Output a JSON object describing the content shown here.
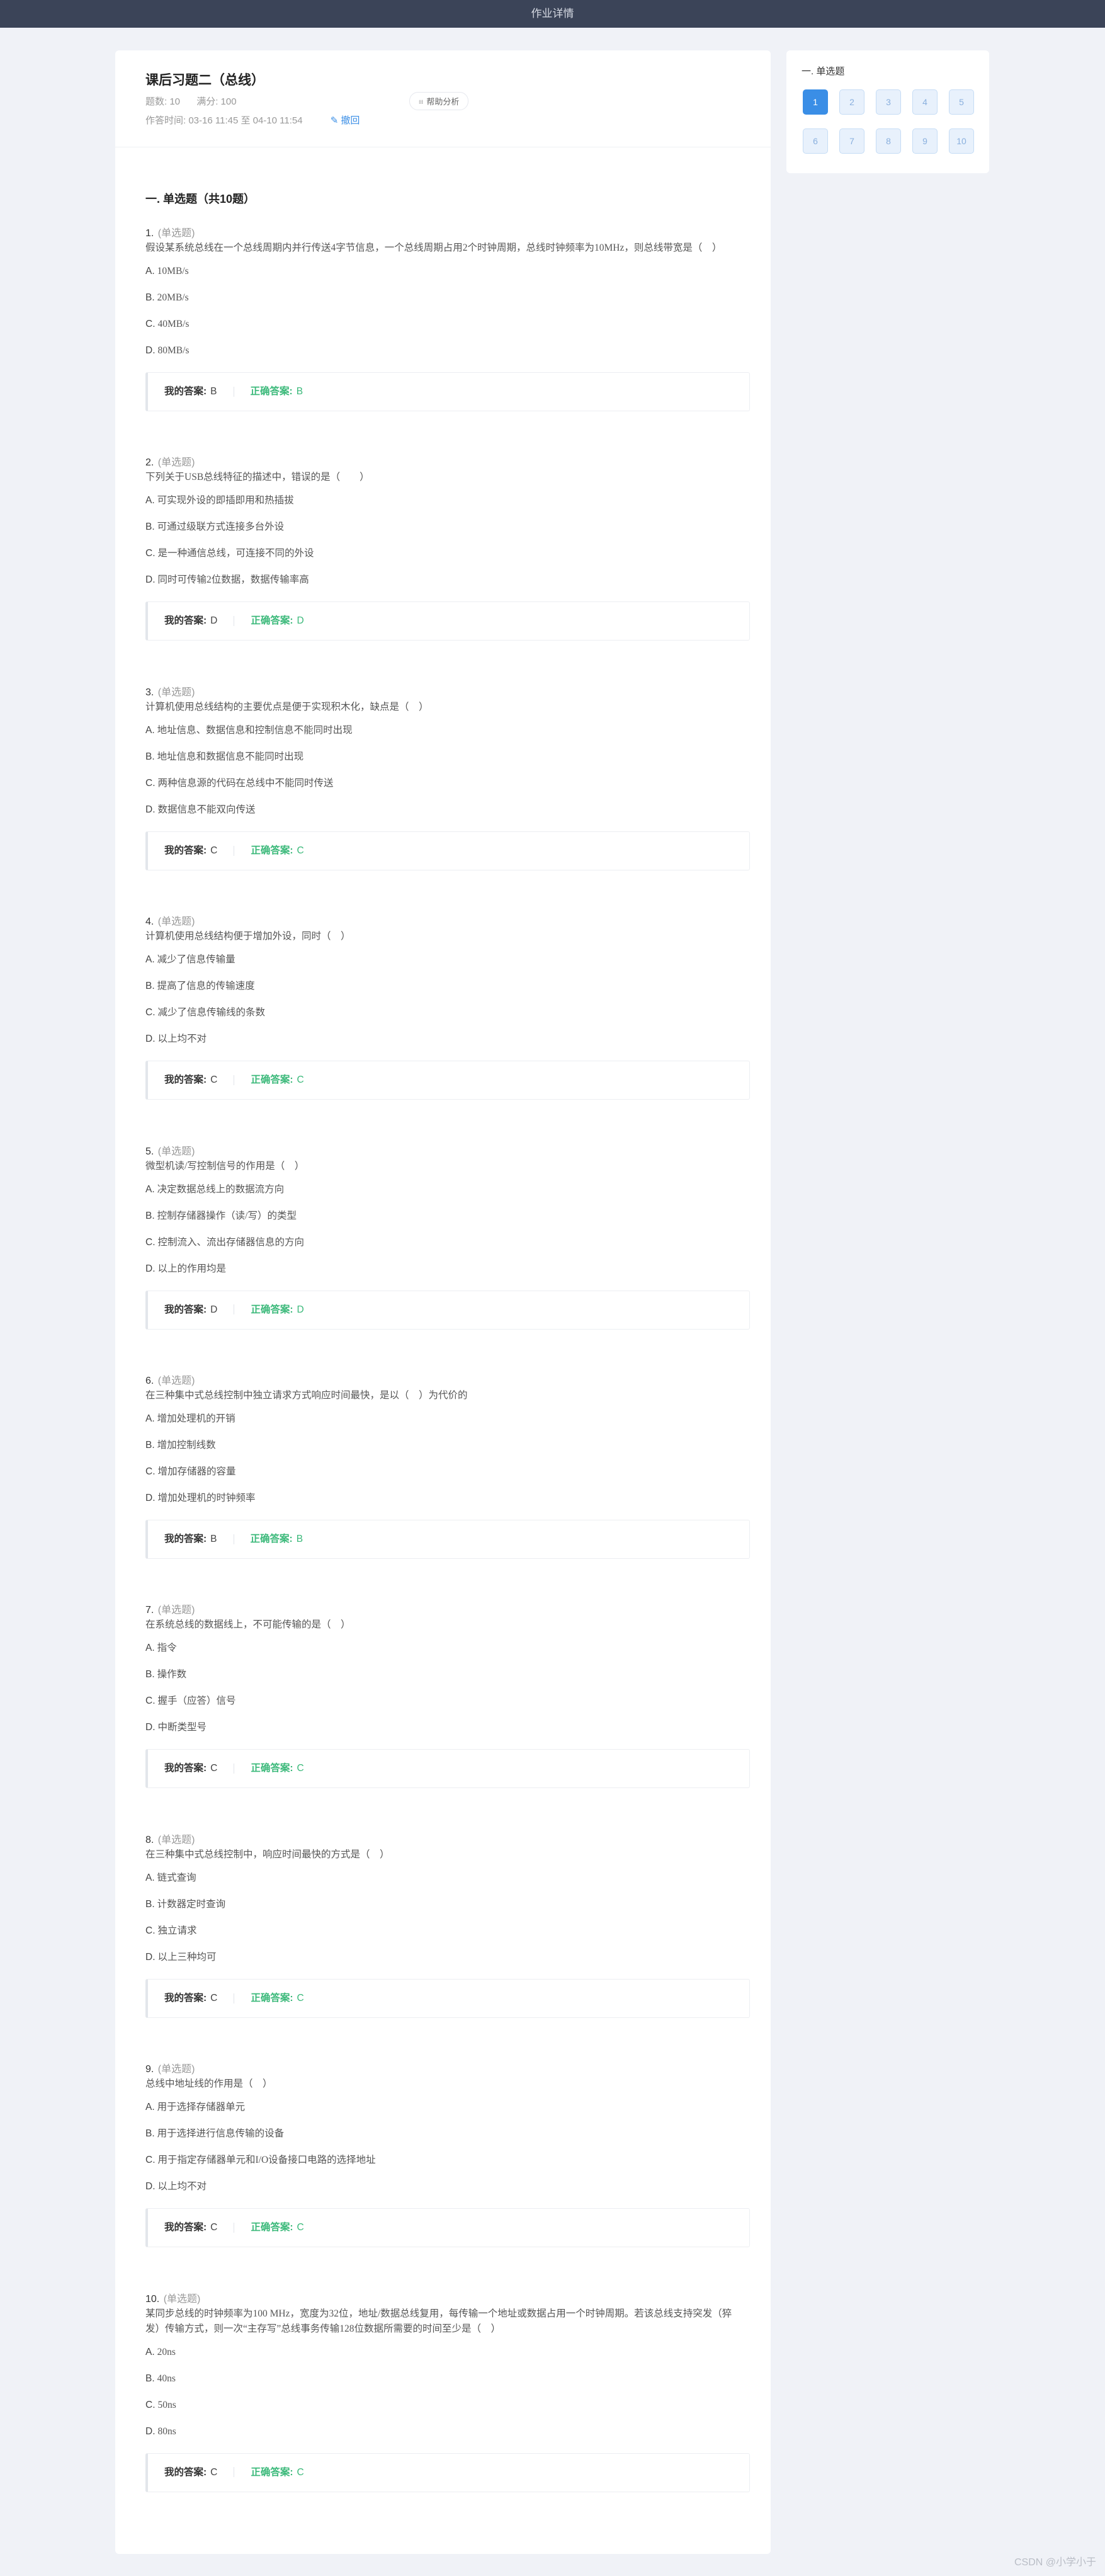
{
  "topbar": {
    "title": "作业详情"
  },
  "homework": {
    "title": "课后习题二（总线）",
    "count_label": "题数: 10",
    "score_label": "满分: 100",
    "time_label": "作答时间: 03-16 11:45  至  04-10 11:54",
    "withdraw_label": "撤回",
    "help_label": "帮助分析"
  },
  "section": {
    "title": "一. 单选题（共10题）"
  },
  "labels": {
    "my_answer": "我的答案:",
    "correct_answer": "正确答案:"
  },
  "questions": [
    {
      "num": "1.",
      "type": "(单选题)",
      "stem": "假设某系统总线在一个总线周期内并行传送4字节信息，一个总线周期占用2个时钟周期，总线时钟频率为10MHz，则总线带宽是（　）",
      "options": [
        {
          "letter": "A.",
          "text": "10MB/s"
        },
        {
          "letter": "B.",
          "text": "20MB/s"
        },
        {
          "letter": "C.",
          "text": "40MB/s"
        },
        {
          "letter": "D.",
          "text": "80MB/s"
        }
      ],
      "my": "B",
      "correct": "B"
    },
    {
      "num": "2.",
      "type": "(单选题)",
      "stem": "下列关于USB总线特征的描述中，错误的是（　　）",
      "options": [
        {
          "letter": "A.",
          "text": "可实现外设的即插即用和热插拔"
        },
        {
          "letter": "B.",
          "text": "可通过级联方式连接多台外设"
        },
        {
          "letter": "C.",
          "text": "是一种通信总线，可连接不同的外设"
        },
        {
          "letter": "D.",
          "text": "同时可传输2位数据，数据传输率高"
        }
      ],
      "my": "D",
      "correct": "D"
    },
    {
      "num": "3.",
      "type": "(单选题)",
      "stem": "计算机使用总线结构的主要优点是便于实现积木化，缺点是（　）",
      "options": [
        {
          "letter": "A.",
          "text": "地址信息、数据信息和控制信息不能同时出现"
        },
        {
          "letter": "B.",
          "text": "地址信息和数据信息不能同时出现"
        },
        {
          "letter": "C.",
          "text": "两种信息源的代码在总线中不能同时传送"
        },
        {
          "letter": "D.",
          "text": "数据信息不能双向传送"
        }
      ],
      "my": "C",
      "correct": "C"
    },
    {
      "num": "4.",
      "type": "(单选题)",
      "stem": "计算机使用总线结构便于增加外设，同时（　）",
      "options": [
        {
          "letter": "A.",
          "text": "减少了信息传输量"
        },
        {
          "letter": "B.",
          "text": "提高了信息的传输速度"
        },
        {
          "letter": "C.",
          "text": "减少了信息传输线的条数"
        },
        {
          "letter": "D.",
          "text": "以上均不对"
        }
      ],
      "my": "C",
      "correct": "C"
    },
    {
      "num": "5.",
      "type": "(单选题)",
      "stem": "微型机读/写控制信号的作用是（　）",
      "options": [
        {
          "letter": "A.",
          "text": "决定数据总线上的数据流方向"
        },
        {
          "letter": "B.",
          "text": "控制存储器操作（读/写）的类型"
        },
        {
          "letter": "C.",
          "text": "控制流入、流出存储器信息的方向"
        },
        {
          "letter": "D.",
          "text": "以上的作用均是"
        }
      ],
      "my": "D",
      "correct": "D"
    },
    {
      "num": "6.",
      "type": "(单选题)",
      "stem": "在三种集中式总线控制中独立请求方式响应时间最快，是以（　）为代价的",
      "options": [
        {
          "letter": "A.",
          "text": "增加处理机的开销"
        },
        {
          "letter": "B.",
          "text": "增加控制线数"
        },
        {
          "letter": "C.",
          "text": "增加存储器的容量"
        },
        {
          "letter": "D.",
          "text": "增加处理机的时钟频率"
        }
      ],
      "my": "B",
      "correct": "B"
    },
    {
      "num": "7.",
      "type": "(单选题)",
      "stem": "在系统总线的数据线上，不可能传输的是（　）",
      "options": [
        {
          "letter": "A.",
          "text": "指令"
        },
        {
          "letter": "B.",
          "text": "操作数"
        },
        {
          "letter": "C.",
          "text": "握手（应答）信号"
        },
        {
          "letter": "D.",
          "text": "中断类型号"
        }
      ],
      "my": "C",
      "correct": "C"
    },
    {
      "num": "8.",
      "type": "(单选题)",
      "stem": "在三种集中式总线控制中，响应时间最快的方式是（　）",
      "options": [
        {
          "letter": "A.",
          "text": "链式查询"
        },
        {
          "letter": "B.",
          "text": "计数器定时查询"
        },
        {
          "letter": "C.",
          "text": "独立请求"
        },
        {
          "letter": "D.",
          "text": "以上三种均可"
        }
      ],
      "my": "C",
      "correct": "C"
    },
    {
      "num": "9.",
      "type": "(单选题)",
      "stem": "总线中地址线的作用是（　）",
      "options": [
        {
          "letter": "A.",
          "text": "用于选择存储器单元"
        },
        {
          "letter": "B.",
          "text": "用于选择进行信息传输的设备"
        },
        {
          "letter": "C.",
          "text": "用于指定存储器单元和I/O设备接口电路的选择地址"
        },
        {
          "letter": "D.",
          "text": "以上均不对"
        }
      ],
      "my": "C",
      "correct": "C"
    },
    {
      "num": "10.",
      "type": "(单选题)",
      "stem": "某同步总线的时钟频率为100 MHz，宽度为32位，地址/数据总线复用，每传输一个地址或数据占用一个时钟周期。若该总线支持突发（猝发）传输方式，则一次“主存写”总线事务传输128位数据所需要的时间至少是（　）",
      "options": [
        {
          "letter": "A.",
          "text": "20ns"
        },
        {
          "letter": "B.",
          "text": "40ns"
        },
        {
          "letter": "C.",
          "text": "50ns"
        },
        {
          "letter": "D.",
          "text": "80ns"
        }
      ],
      "my": "C",
      "correct": "C"
    }
  ],
  "sidebar": {
    "title": "一. 单选题",
    "active_index": 0,
    "items": [
      "1",
      "2",
      "3",
      "4",
      "5",
      "6",
      "7",
      "8",
      "9",
      "10"
    ]
  },
  "watermark": "CSDN @小学小于",
  "colors": {
    "accent": "#3a8ee6",
    "correct": "#3bb97a",
    "topbar": "#3b4458"
  }
}
